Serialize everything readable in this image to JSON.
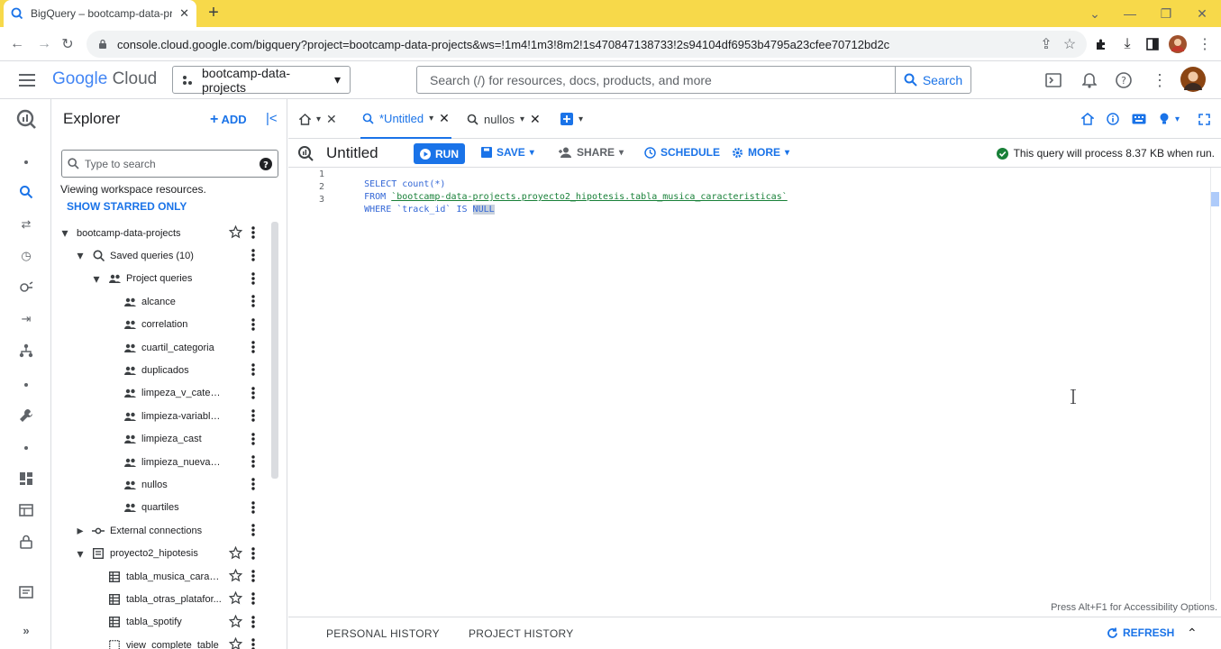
{
  "browser": {
    "tab_title": "BigQuery – bootcamp-data-proj",
    "new_tab": "+",
    "url": "console.cloud.google.com/bigquery?project=bootcamp-data-projects&ws=!1m4!1m3!8m2!1s470847138733!2s94104df6953b4795a23cfee70712bd2c"
  },
  "header": {
    "logo_google": "Google",
    "logo_cloud": "Cloud",
    "project": "bootcamp-data-projects",
    "search_placeholder": "Search (/) for resources, docs, products, and more",
    "search_button": "Search"
  },
  "explorer": {
    "title": "Explorer",
    "add_label": "ADD",
    "search_placeholder": "Type to search",
    "viewing_text": "Viewing workspace resources.",
    "starred_link": "SHOW STARRED ONLY",
    "tree": [
      {
        "label": "bootcamp-data-projects",
        "level": 0,
        "caret": "down",
        "icon": "none",
        "star": true
      },
      {
        "label": "Saved queries (10)",
        "level": 1,
        "caret": "down",
        "icon": "saved-query",
        "star": false
      },
      {
        "label": "Project queries",
        "level": 2,
        "caret": "down",
        "icon": "people",
        "star": false
      },
      {
        "label": "alcance",
        "level": 3,
        "caret": "none",
        "icon": "people",
        "star": false
      },
      {
        "label": "correlation",
        "level": 3,
        "caret": "none",
        "icon": "people",
        "star": false
      },
      {
        "label": "cuartil_categoria",
        "level": 3,
        "caret": "none",
        "icon": "people",
        "star": false
      },
      {
        "label": "duplicados",
        "level": 3,
        "caret": "none",
        "icon": "people",
        "star": false
      },
      {
        "label": "limpeza_v_categoricas",
        "level": 3,
        "caret": "none",
        "icon": "people",
        "star": false
      },
      {
        "label": "limpieza-variables-nu...",
        "level": 3,
        "caret": "none",
        "icon": "people",
        "star": false
      },
      {
        "label": "limpieza_cast",
        "level": 3,
        "caret": "none",
        "icon": "people",
        "star": false
      },
      {
        "label": "limpieza_nueva_varia...",
        "level": 3,
        "caret": "none",
        "icon": "people",
        "star": false
      },
      {
        "label": "nullos",
        "level": 3,
        "caret": "none",
        "icon": "people",
        "star": false
      },
      {
        "label": "quartiles",
        "level": 3,
        "caret": "none",
        "icon": "people",
        "star": false
      },
      {
        "label": "External connections",
        "level": 1,
        "caret": "right",
        "icon": "connection",
        "star": false
      },
      {
        "label": "proyecto2_hipotesis",
        "level": 1,
        "caret": "down",
        "icon": "dataset",
        "star": true
      },
      {
        "label": "tabla_musica_caract...",
        "level": 2,
        "caret": "none",
        "icon": "table",
        "star": true
      },
      {
        "label": "tabla_otras_platafor...",
        "level": 2,
        "caret": "none",
        "icon": "table",
        "star": true
      },
      {
        "label": "tabla_spotify",
        "level": 2,
        "caret": "none",
        "icon": "table",
        "star": true
      },
      {
        "label": "view_complete_table",
        "level": 2,
        "caret": "none",
        "icon": "view",
        "star": true
      }
    ]
  },
  "editor": {
    "tabs": [
      {
        "label": "*Untitled",
        "active": true
      },
      {
        "label": "nullos",
        "active": false
      }
    ],
    "query_title": "Untitled",
    "run": "RUN",
    "save": "SAVE",
    "share": "SHARE",
    "schedule": "SCHEDULE",
    "more": "MORE",
    "query_info": "This query will process 8.37 KB when run.",
    "code_lines": [
      {
        "n": "1",
        "a": "SELECT count(*)"
      },
      {
        "n": "2",
        "a": "FROM ",
        "s": "`bootcamp-data-projects.proyecto2_hipotesis.tabla_musica_caracteristicas`"
      },
      {
        "n": "3",
        "a": "WHERE `track_id` IS ",
        "h": "NULL"
      }
    ],
    "a11y_hint": "Press Alt+F1 for Accessibility Options.",
    "personal_history": "PERSONAL HISTORY",
    "project_history": "PROJECT HISTORY",
    "refresh": "REFRESH"
  },
  "colors": {
    "accent": "#1a73e8",
    "tabbar": "#f7d94a",
    "success": "#188038"
  }
}
